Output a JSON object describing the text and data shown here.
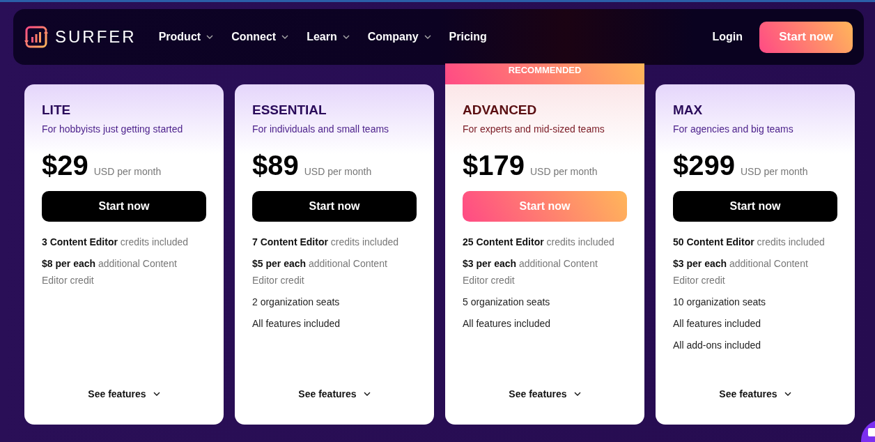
{
  "nav": {
    "brand": "SURFER",
    "items": [
      {
        "label": "Product",
        "dropdown": true
      },
      {
        "label": "Connect",
        "dropdown": true
      },
      {
        "label": "Learn",
        "dropdown": true
      },
      {
        "label": "Company",
        "dropdown": true
      },
      {
        "label": "Pricing",
        "dropdown": false
      }
    ],
    "login": "Login",
    "cta": "Start now"
  },
  "plans": [
    {
      "name": "LITE",
      "tagline": "For hobbyists just getting started",
      "price": "$29",
      "period": "USD per month",
      "button": "Start now",
      "highlighted": false,
      "features": [
        "**3 Content Editor** credits included",
        "**$8 per each** additional Content Editor credit"
      ],
      "more": "See features"
    },
    {
      "name": "ESSENTIAL",
      "tagline": "For individuals and small teams",
      "price": "$89",
      "period": "USD per month",
      "button": "Start now",
      "highlighted": false,
      "features": [
        "**7 Content Editor** credits included",
        "**$5 per each** additional Content Editor credit",
        "2 organization seats",
        "All features included"
      ],
      "more": "See features"
    },
    {
      "name": "ADVANCED",
      "tagline": "For experts and mid-sized teams",
      "price": "$179",
      "period": "USD per month",
      "button": "Start now",
      "highlighted": true,
      "badge": "RECOMMENDED",
      "features": [
        "**25 Content Editor** credits included",
        "**$3 per each** additional Content Editor credit",
        "5 organization seats",
        "All features included"
      ],
      "more": "See features"
    },
    {
      "name": "MAX",
      "tagline": "For agencies and big teams",
      "price": "$299",
      "period": "USD per month",
      "button": "Start now",
      "highlighted": false,
      "features": [
        "**50 Content Editor** credits included",
        "**$3 per each** additional Content Editor credit",
        "10 organization seats",
        "All features included",
        "All add-ons included"
      ],
      "more": "See features"
    }
  ]
}
